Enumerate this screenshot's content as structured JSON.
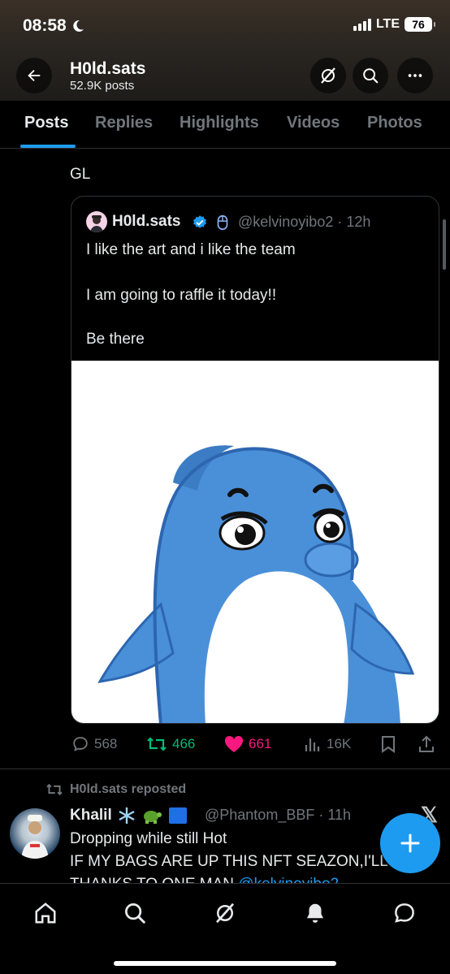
{
  "status_bar": {
    "time": "08:58",
    "network": "LTE",
    "battery": "76"
  },
  "header": {
    "title": "H0ld.sats",
    "subtitle": "52.9K posts"
  },
  "tabs": [
    {
      "label": "Posts",
      "active": true
    },
    {
      "label": "Replies",
      "active": false
    },
    {
      "label": "Highlights",
      "active": false
    },
    {
      "label": "Videos",
      "active": false
    },
    {
      "label": "Photos",
      "active": false
    }
  ],
  "post": {
    "text": "GL",
    "quote": {
      "name": "H0ld.sats",
      "handle": "@kelvinoyibo2",
      "time": "12h",
      "handle_time": "@kelvinoyibo2 · 12h",
      "lines": [
        "I like the art and i like the team",
        "I am going to raffle it today!!",
        "Be there"
      ]
    },
    "stats": {
      "replies": "568",
      "reposts": "466",
      "likes": "661",
      "views": "16K"
    }
  },
  "second_post": {
    "repost_label": "H0ld.sats reposted",
    "name": "Khalil",
    "handle_time": "@Phantom_BBF · 11h",
    "line1": "Dropping while still Hot",
    "line2": "IF MY BAGS ARE UP THIS NFT SEAZON,I'LL",
    "line3_prefix": "THANKS TO ONE MAN ",
    "line3_mention": "@kelvinoyibo2"
  },
  "colors": {
    "accent": "#1d9bf0",
    "repost_green": "#00ba7c",
    "like_pink": "#f91880",
    "muted": "#71767b",
    "text": "#e7e9ea"
  },
  "icons": {
    "back": "arrow-left-icon",
    "grok": "grok-icon",
    "search": "search-icon",
    "more": "more-icon",
    "reply": "reply-icon",
    "repost": "repost-icon",
    "like": "heart-icon",
    "views": "views-icon",
    "bookmark": "bookmark-icon",
    "share": "share-icon",
    "compose": "plus-icon",
    "nav": [
      "home-icon",
      "search-icon",
      "grok-icon",
      "bell-icon",
      "messages-icon"
    ]
  }
}
